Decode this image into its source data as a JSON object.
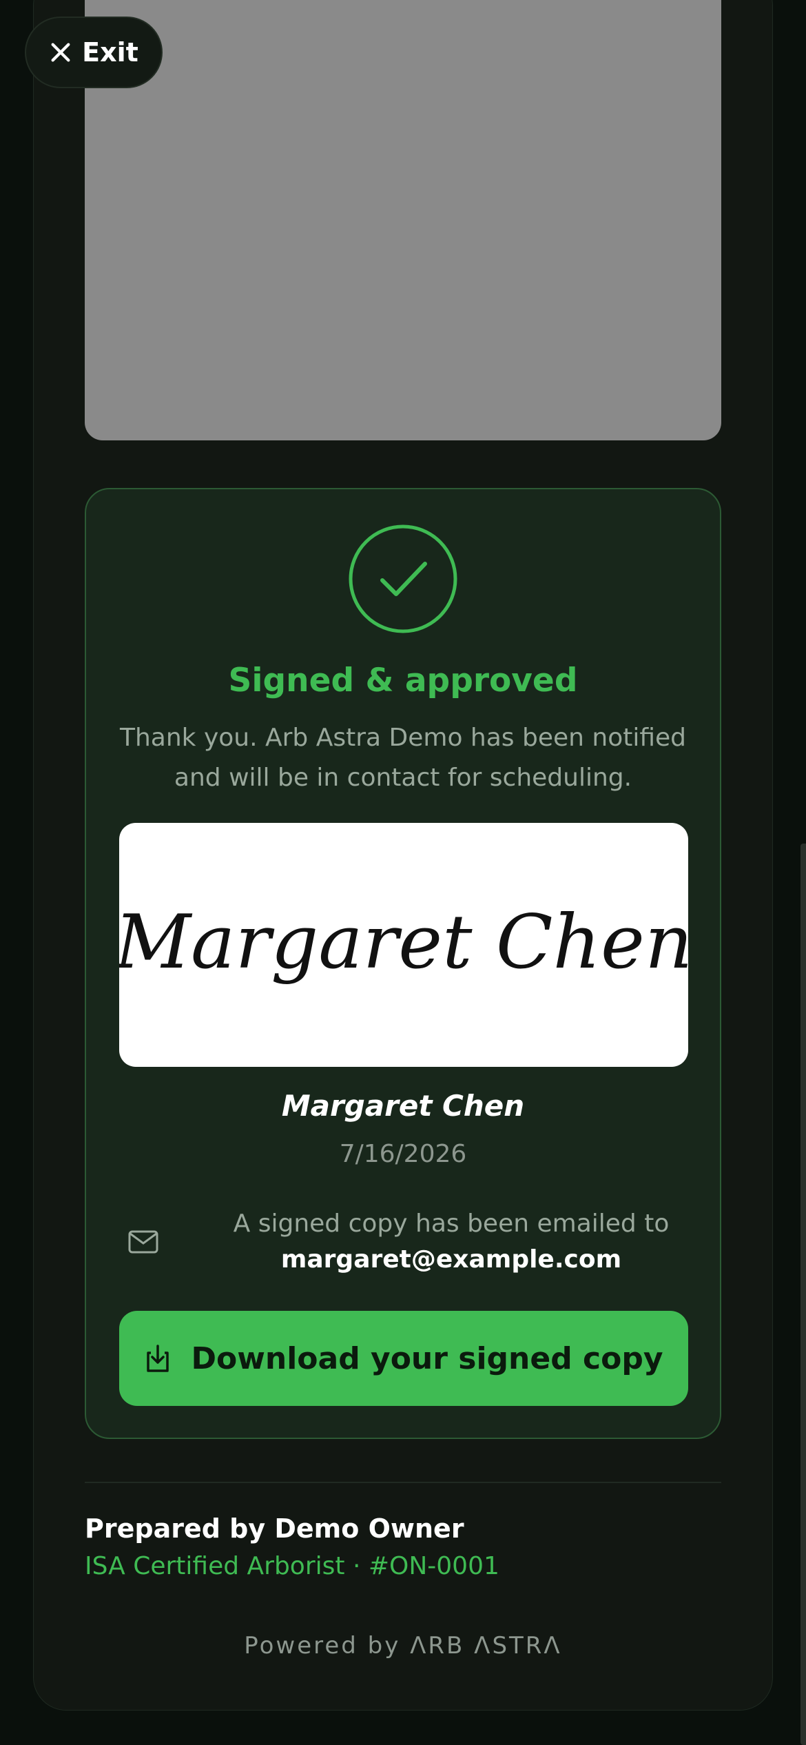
{
  "header": {
    "exit_label": "Exit"
  },
  "status": {
    "title": "Signed & approved",
    "message": "Thank you. Arb Astra Demo has been notified and will be in contact for scheduling."
  },
  "signature": {
    "script_text": "Margaret Chen",
    "signer_name": "Margaret Chen",
    "date": "7/16/2026"
  },
  "email_notice": {
    "prefix": "A signed copy has been emailed to",
    "address": "margaret@example.com"
  },
  "download": {
    "label": "Download your signed copy"
  },
  "footer": {
    "prepared_by": "Prepared by Demo Owner",
    "credentials": "ISA Certified Arborist · #ON-0001",
    "powered_by": "Powered by ΛRB ΛSTRΛ"
  },
  "colors": {
    "accent": "#3fbb53",
    "background": "#0a100c",
    "panel": "#18271b"
  },
  "icons": [
    "close-icon",
    "checkmark-icon",
    "mail-icon",
    "download-icon"
  ]
}
